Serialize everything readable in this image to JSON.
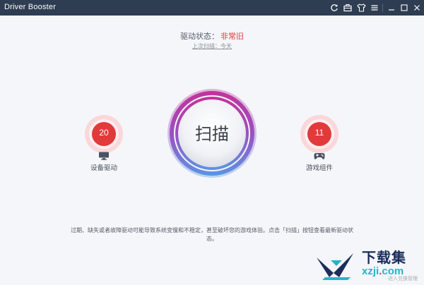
{
  "window": {
    "title": "Driver Booster",
    "toolbar_icons": [
      "refresh-icon",
      "toolbox-icon",
      "shirt-icon",
      "menu-icon"
    ],
    "controls": [
      "minimize-icon",
      "maximize-icon",
      "close-icon"
    ]
  },
  "status": {
    "label": "驱动状态：",
    "value": "非常旧",
    "last_scan": "上次扫描：今天"
  },
  "scan": {
    "label": "扫描"
  },
  "device_drivers": {
    "count": "20",
    "label": "设备驱动",
    "icon": "monitor-icon"
  },
  "game_components": {
    "count": "11",
    "label": "游戏组件",
    "icon": "gamepad-icon"
  },
  "footer": {
    "message": "过期、缺失或者故障驱动可能导致系统变慢和不稳定，甚至破坏您的游戏体验。点击「扫描」按钮查看最新驱动状态。"
  },
  "watermark": {
    "cn": "下载集",
    "en_prefix": "xzji",
    "en_dot": ".",
    "en_suffix": "com",
    "faint": "进入兑换管理"
  },
  "colors": {
    "titlebar": "#2f3d52",
    "status_red": "#e23c3c",
    "ring_top": "#c2339a",
    "ring_bottom": "#5b95e3",
    "badge_red": "#e23a3a"
  }
}
